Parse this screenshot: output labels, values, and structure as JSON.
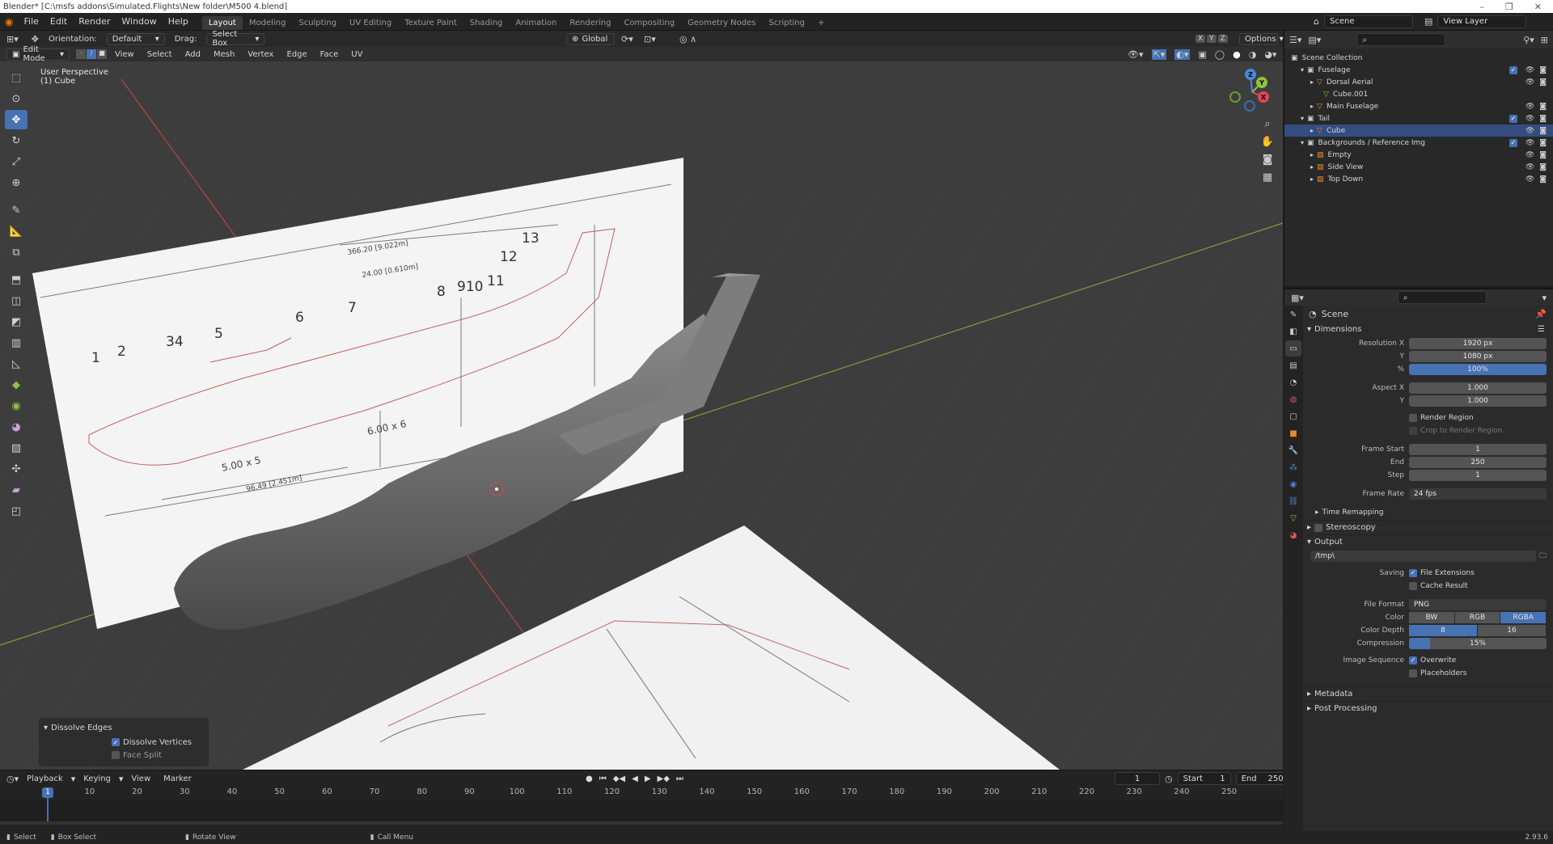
{
  "window": {
    "title": "Blender* [C:\\msfs addons\\Simulated.Flights\\New folder\\M500 4.blend]",
    "controls": [
      "–",
      "❐",
      "✕"
    ]
  },
  "topbar": {
    "menus": [
      "File",
      "Edit",
      "Render",
      "Window",
      "Help"
    ],
    "workspaces": [
      "Layout",
      "Modeling",
      "Sculpting",
      "UV Editing",
      "Texture Paint",
      "Shading",
      "Animation",
      "Rendering",
      "Compositing",
      "Geometry Nodes",
      "Scripting"
    ],
    "active_workspace": "Layout",
    "add_tab": "+",
    "scene": "Scene",
    "view_layer": "View Layer"
  },
  "viewport_header": {
    "orientation_label": "Orientation:",
    "orientation_value": "Default",
    "drag_label": "Drag:",
    "drag_value": "Select Box",
    "transform_orientation": "Global",
    "options": "Options",
    "axes": [
      "X",
      "Y",
      "Z"
    ],
    "mode": "Edit Mode",
    "menus": [
      "View",
      "Select",
      "Add",
      "Mesh",
      "Vertex",
      "Edge",
      "Face",
      "UV"
    ]
  },
  "viewport": {
    "perspective": "User Perspective",
    "object": "(1) Cube",
    "blueprint_numbers": [
      "1",
      "2",
      "34",
      "5",
      "6",
      "7",
      "8",
      "910",
      "11",
      "12",
      "13"
    ],
    "blueprint_dims": [
      "366.20 [9.022m]",
      "24.00 [0.610m]",
      "6.00 x 6",
      "5.00 x 5",
      "96.49 [2.451m]"
    ],
    "gizmo": {
      "x": "X",
      "y": "Y",
      "z": "Z"
    }
  },
  "operator_panel": {
    "title": "Dissolve Edges",
    "options": [
      {
        "label": "Dissolve Vertices",
        "checked": true
      },
      {
        "label": "Face Split",
        "checked": false
      }
    ]
  },
  "timeline": {
    "menus": [
      "Playback",
      "Keying",
      "View",
      "Marker"
    ],
    "current_frame": "1",
    "start_label": "Start",
    "start": "1",
    "end_label": "End",
    "end": "250",
    "ruler": [
      "10",
      "20",
      "30",
      "40",
      "50",
      "60",
      "70",
      "80",
      "90",
      "100",
      "110",
      "120",
      "130",
      "140",
      "150",
      "160",
      "170",
      "180",
      "190",
      "200",
      "210",
      "220",
      "230",
      "240",
      "250"
    ],
    "playhead": "1"
  },
  "statusbar": {
    "items": [
      "Select",
      "Box Select",
      "Rotate View",
      "Call Menu"
    ],
    "version": "2.93.6"
  },
  "outliner": {
    "root": "Scene Collection",
    "rows": [
      {
        "label": "Fuselage",
        "indent": 1,
        "type": "collection",
        "selected": false
      },
      {
        "label": "Dorsal Aerial",
        "indent": 2,
        "type": "mesh-object",
        "selected": false
      },
      {
        "label": "Cube.001",
        "indent": 3,
        "type": "mesh-data",
        "selected": false
      },
      {
        "label": "Main Fuselage",
        "indent": 2,
        "type": "mesh-object",
        "selected": false
      },
      {
        "label": "Tail",
        "indent": 1,
        "type": "collection",
        "selected": false
      },
      {
        "label": "Cube",
        "indent": 2,
        "type": "mesh-object",
        "selected": true
      },
      {
        "label": "Backgrounds / Reference Img",
        "indent": 1,
        "type": "collection",
        "selected": false
      },
      {
        "label": "Empty",
        "indent": 2,
        "type": "image-empty",
        "selected": false
      },
      {
        "label": "Side View",
        "indent": 2,
        "type": "image-empty",
        "selected": false
      },
      {
        "label": "Top Down",
        "indent": 2,
        "type": "image-empty",
        "selected": false
      }
    ]
  },
  "properties": {
    "context": "Scene",
    "dimensions": {
      "title": "Dimensions",
      "res_x_label": "Resolution X",
      "res_x": "1920 px",
      "res_y_label": "Y",
      "res_y": "1080 px",
      "res_pct_label": "%",
      "res_pct": "100%",
      "aspect_x_label": "Aspect X",
      "aspect_x": "1.000",
      "aspect_y_label": "Y",
      "aspect_y": "1.000",
      "render_region": "Render Region",
      "crop_region": "Crop to Render Region",
      "frame_start_label": "Frame Start",
      "frame_start": "1",
      "end_label": "End",
      "end": "250",
      "step_label": "Step",
      "step": "1",
      "frame_rate_label": "Frame Rate",
      "frame_rate": "24 fps",
      "time_remapping": "Time Remapping"
    },
    "stereoscopy": "Stereoscopy",
    "output": {
      "title": "Output",
      "path": "/tmp\\",
      "saving_label": "Saving",
      "file_extensions": "File Extensions",
      "cache_result": "Cache Result",
      "file_format_label": "File Format",
      "file_format": "PNG",
      "color_label": "Color",
      "color_options": [
        "BW",
        "RGB",
        "RGBA"
      ],
      "color_selected": "RGBA",
      "depth_label": "Color Depth",
      "depth_options": [
        "8",
        "16"
      ],
      "depth_selected": "8",
      "compression_label": "Compression",
      "compression": "15%",
      "compression_value": 0.15,
      "image_sequence_label": "Image Sequence",
      "overwrite": "Overwrite",
      "placeholders": "Placeholders"
    },
    "metadata": "Metadata",
    "post_processing": "Post Processing"
  },
  "colors": {
    "accent": "#4772b3",
    "selected_row": "#334d80",
    "x_axis": "#e0455a",
    "y_axis": "#8ac43c",
    "z_axis": "#4b86d9"
  }
}
